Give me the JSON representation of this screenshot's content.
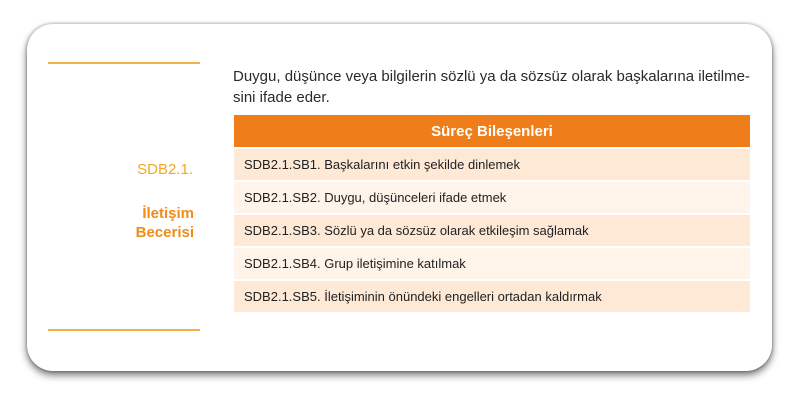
{
  "competency": {
    "code": "SDB2.1.",
    "skill_line1": "İletişim",
    "skill_line2": "Becerisi"
  },
  "description": "Duygu, düşünce veya bilgilerin sözlü ya da sözsüz olarak başkalarına iletilme-sini ifade eder.",
  "table": {
    "header": "Süreç Bileşenleri",
    "rows": [
      "SDB2.1.SB1. Başkalarını etkin şekilde dinlemek",
      "SDB2.1.SB2. Duygu, düşünceleri ifade etmek",
      "SDB2.1.SB3. Sözlü ya da sözsüz olarak etkileşim sağlamak",
      "SDB2.1.SB4. Grup iletişimine katılmak",
      "SDB2.1.SB5. İletişiminin önündeki engelleri ortadan kaldırmak"
    ]
  },
  "colors": {
    "accent": "#ef7d1a",
    "code_text": "#f5a623",
    "row_odd": "#fde9d6",
    "row_even": "#fef4ea"
  }
}
